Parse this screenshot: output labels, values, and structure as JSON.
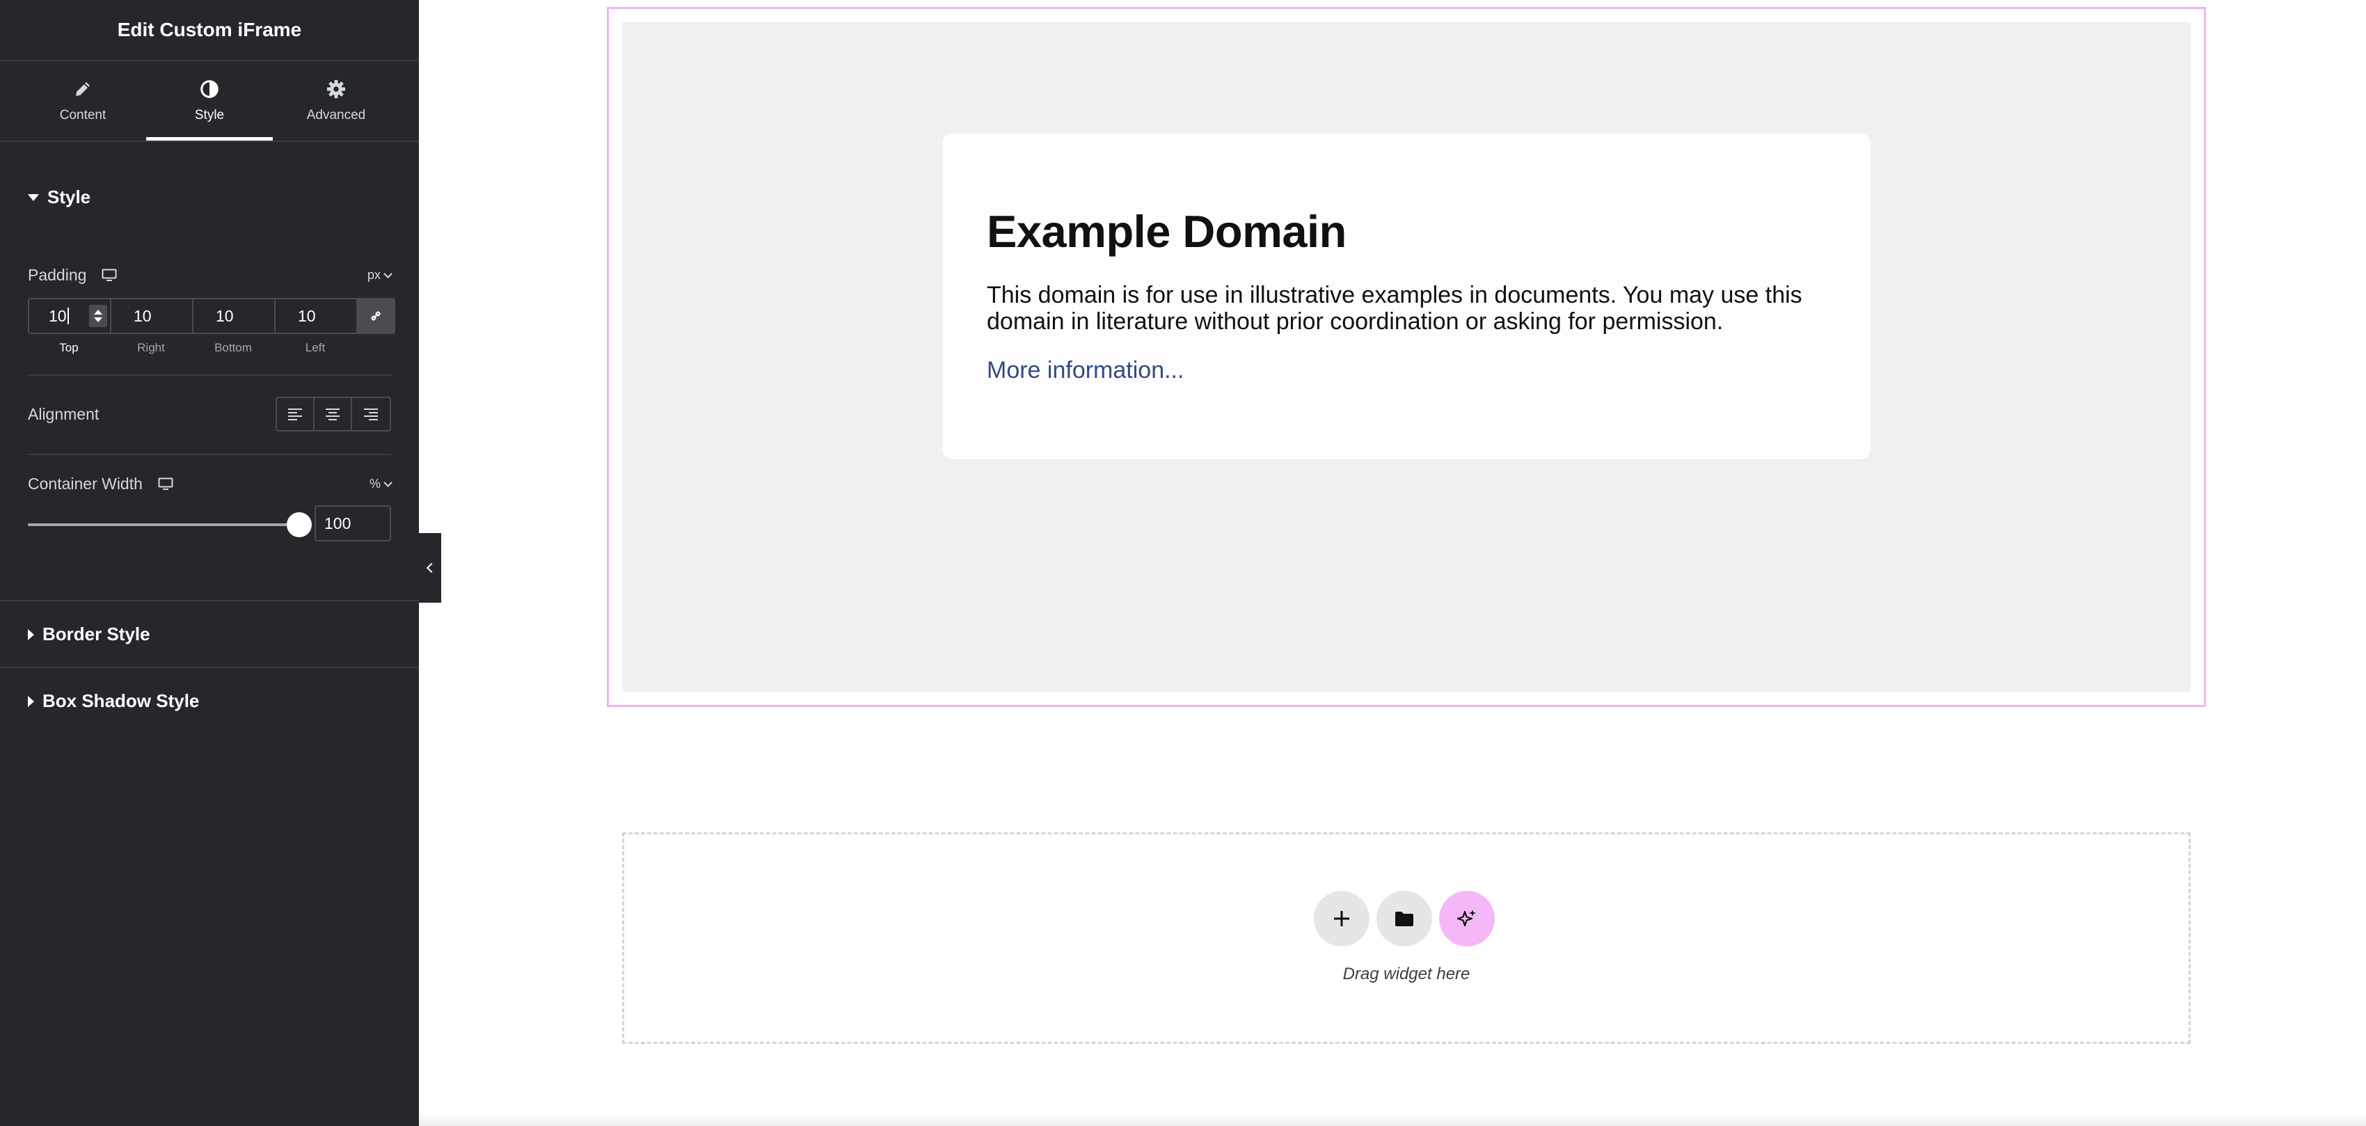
{
  "panel": {
    "title": "Edit Custom iFrame",
    "tabs": [
      {
        "label": "Content",
        "icon": "pencil-icon"
      },
      {
        "label": "Style",
        "icon": "contrast-icon"
      },
      {
        "label": "Advanced",
        "icon": "gear-icon"
      }
    ],
    "active_tab": "Style",
    "style_section": {
      "title": "Style",
      "padding": {
        "label": "Padding",
        "unit": "px",
        "top": "10",
        "right": "10",
        "bottom": "10",
        "left": "10",
        "labels": {
          "top": "Top",
          "right": "Right",
          "bottom": "Bottom",
          "left": "Left"
        }
      },
      "alignment": {
        "label": "Alignment"
      },
      "container_width": {
        "label": "Container Width",
        "unit": "%",
        "value": "100",
        "slider_fraction": 1.0
      }
    },
    "collapsed_sections": [
      "Border Style",
      "Box Shadow Style"
    ]
  },
  "iframe_page": {
    "heading": "Example Domain",
    "body": "This domain is for use in illustrative examples in documents. You may use this domain in literature without prior coordination or asking for permission.",
    "link": "More information..."
  },
  "drop_zone": {
    "text": "Drag widget here"
  },
  "colors": {
    "panel_bg": "#26272b",
    "widget_outline": "#f0b4f5",
    "ai_button": "#f4b8f8",
    "link": "#34497e"
  }
}
